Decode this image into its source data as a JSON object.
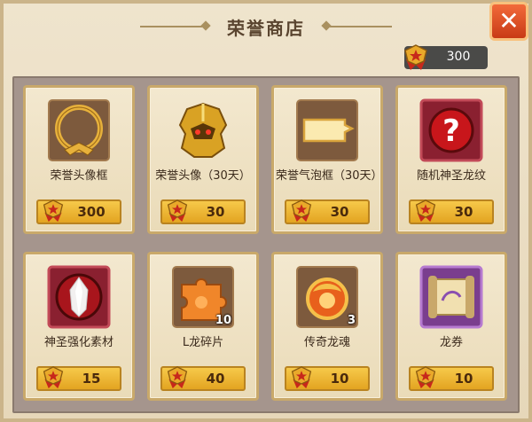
{
  "window": {
    "title": "荣誉商店"
  },
  "currency": {
    "amount": "300",
    "icon": "honor-medal-icon"
  },
  "close": {
    "icon": "close-icon"
  },
  "items": [
    {
      "name": "荣誉头像框",
      "price": "300",
      "icon": "avatar-frame-icon"
    },
    {
      "name": "荣誉头像（30天）",
      "price": "30",
      "icon": "golden-helmet-avatar-icon"
    },
    {
      "name": "荣誉气泡框（30天）",
      "price": "30",
      "icon": "speech-bubble-frame-icon"
    },
    {
      "name": "随机神圣龙纹",
      "price": "30",
      "icon": "question-mark-icon"
    },
    {
      "name": "神圣强化素材",
      "price": "15",
      "icon": "red-crystal-icon"
    },
    {
      "name": "L龙碎片",
      "price": "40",
      "qty": "10",
      "icon": "puzzle-piece-icon"
    },
    {
      "name": "传奇龙魂",
      "price": "10",
      "qty": "3",
      "icon": "dragon-soul-orb-icon"
    },
    {
      "name": "龙券",
      "price": "10",
      "icon": "scroll-icon"
    }
  ],
  "colors": {
    "accent": "#e3a421",
    "close": "#d9441e",
    "panel": "#a5958d"
  }
}
